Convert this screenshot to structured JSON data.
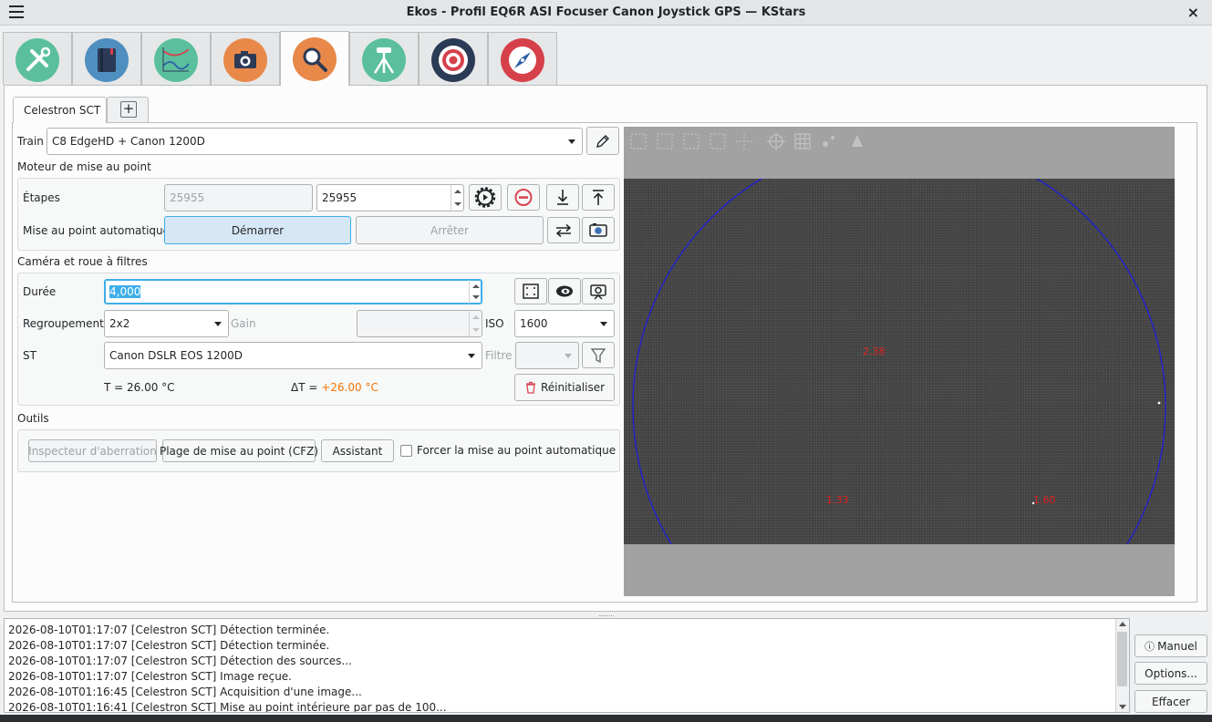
{
  "window": {
    "title": "Ekos - Profil EQ6R ASI Focuser Canon Joystick GPS — KStars",
    "close_glyph": "×"
  },
  "module_tabs": [
    {
      "icon": "setup-icon",
      "color": "#5bbf9e"
    },
    {
      "icon": "scheduler-icon",
      "color": "#4f8fc0"
    },
    {
      "icon": "analyze-icon",
      "color": "#5bbf9e"
    },
    {
      "icon": "camera-icon",
      "color": "#e8894a"
    },
    {
      "icon": "focus-icon",
      "color": "#e8894a",
      "active": true
    },
    {
      "icon": "mount-icon",
      "color": "#5bbf9e"
    },
    {
      "icon": "guide-icon",
      "color": "#2b3a55"
    },
    {
      "icon": "align-icon",
      "color": "#d6404a"
    }
  ],
  "subtabs": {
    "active_label": "Celestron SCT",
    "add_glyph": "+"
  },
  "train": {
    "label": "Train",
    "value": "C8 EdgeHD + Canon 1200D"
  },
  "focuser": {
    "section_label": "Moteur de mise au point",
    "steps_label": "Étapes",
    "steps_current": "25955",
    "steps_target": "25955",
    "autofocus_label": "Mise au point automatique",
    "start_label": "Démarrer",
    "stop_label": "Arrêter"
  },
  "camera": {
    "section_label": "Caméra et roue à filtres",
    "duration_label": "Durée",
    "duration_value": "4,000",
    "binning_label": "Regroupement",
    "binning_value": "2x2",
    "gain_label": "Gain",
    "gain_value": "",
    "iso_label": "ISO",
    "iso_value": "1600",
    "st_label": "ST",
    "st_value": "Canon DSLR EOS 1200D",
    "filter_label": "Filtre",
    "filter_value": "",
    "temp_text": "T = 26.00 °C",
    "delta_prefix": "ΔT = ",
    "delta_value": "+26.00 °C",
    "reset_label": "Réinitialiser"
  },
  "tools": {
    "section_label": "Outils",
    "aberration_label": "Inspecteur d'aberration",
    "cfz_label": "Plage de mise au point (CFZ)",
    "wizard_label": "Assistant",
    "force_af_label": "Forcer la mise au point automatique",
    "force_af_checked": false
  },
  "viewer": {
    "star_labels": [
      {
        "text": "2.38",
        "color": "#e02020"
      },
      {
        "text": "1.33",
        "color": "#e02020"
      },
      {
        "text": "1.60",
        "color": "#e02020"
      }
    ],
    "circle_color": "#2020d0"
  },
  "log": {
    "lines": [
      "2026-08-10T01:17:07 [Celestron SCT] Détection terminée.",
      "2026-08-10T01:17:07 [Celestron SCT] Détection terminée.",
      "2026-08-10T01:17:07 [Celestron SCT] Détection des sources...",
      "2026-08-10T01:17:07 [Celestron SCT] Image reçue.",
      "2026-08-10T01:16:45 [Celestron SCT] Acquisition d'une image...",
      "2026-08-10T01:16:41 [Celestron SCT] Mise au point intérieure par pas de 100..."
    ]
  },
  "log_buttons": {
    "manual_label": "Manuel",
    "options_label": "Options...",
    "clear_label": "Effacer"
  }
}
